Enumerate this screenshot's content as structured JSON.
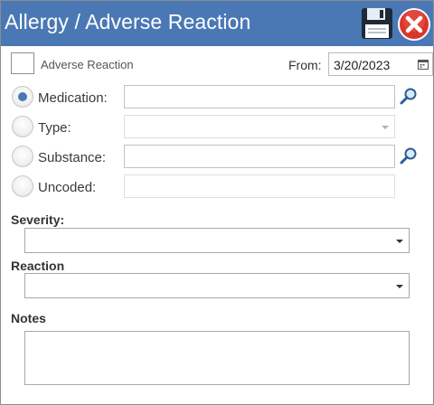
{
  "window": {
    "title": "Allergy / Adverse Reaction",
    "title_bar_color": "#4a78b5",
    "save_icon": "floppy-disk-save-icon",
    "close_icon": "red-x-close-icon"
  },
  "adverse_reaction": {
    "label": "Adverse Reaction",
    "checked": false
  },
  "from": {
    "label": "From:",
    "value": "3/20/2023",
    "icon": "calendar-icon"
  },
  "code_type": {
    "options": [
      {
        "label": "Medication:",
        "selected": true,
        "field_value": "",
        "field_kind": "text",
        "action_icon": "magnifier-search-icon"
      },
      {
        "label": "Type:",
        "selected": false,
        "field_value": "",
        "field_kind": "dropdown-disabled"
      },
      {
        "label": "Substance:",
        "selected": false,
        "field_value": "",
        "field_kind": "text",
        "action_icon": "magnifier-search-icon"
      },
      {
        "label": "Uncoded:",
        "selected": false,
        "field_value": "",
        "field_kind": "text-disabled"
      }
    ]
  },
  "severity": {
    "label": "Severity:",
    "value": ""
  },
  "reaction": {
    "label": "Reaction",
    "value": ""
  },
  "notes": {
    "label": "Notes",
    "value": ""
  }
}
